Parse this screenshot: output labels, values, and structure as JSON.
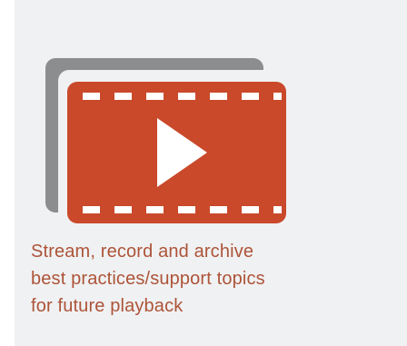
{
  "feature": {
    "icon": "video-film-icon",
    "caption_lines": [
      "Stream, record and archive",
      "best practices/support topics",
      "for future playback"
    ]
  },
  "colors": {
    "background": "#f0f1f3",
    "accent": "#c9492a",
    "shadow": "#8c8d8f",
    "caption_text": "#ad5438"
  }
}
